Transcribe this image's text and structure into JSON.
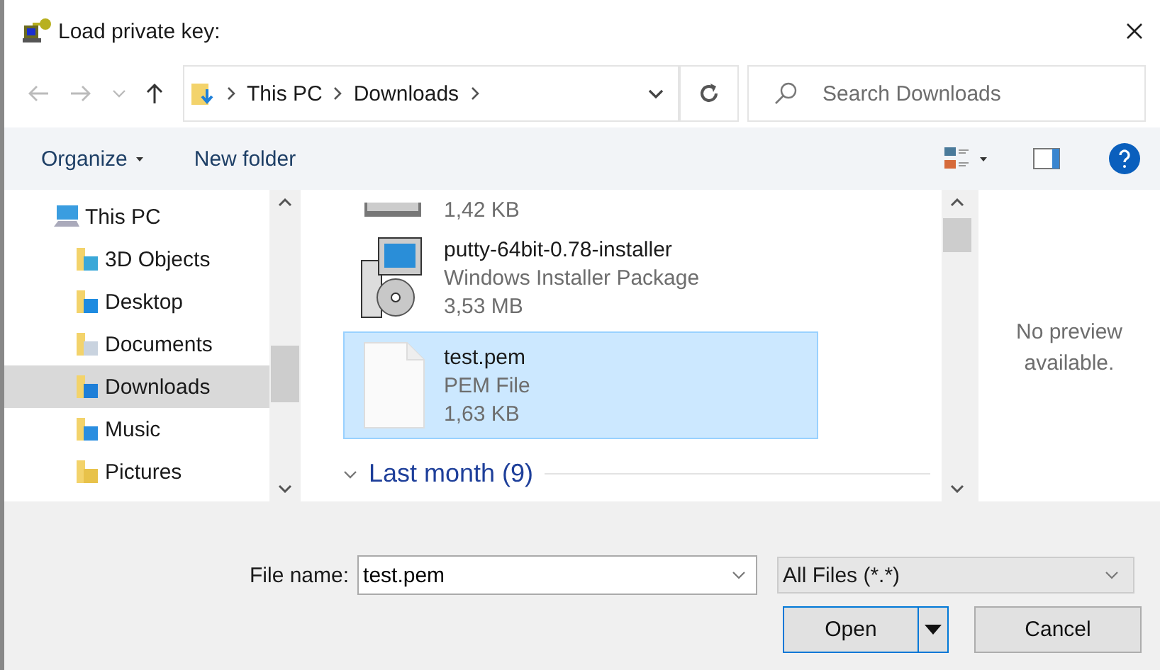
{
  "window": {
    "title": "Load private key:"
  },
  "address": {
    "crumbs": [
      "This PC",
      "Downloads"
    ]
  },
  "search": {
    "placeholder": "Search Downloads"
  },
  "toolbar": {
    "organize": "Organize",
    "new_folder": "New folder"
  },
  "nav": [
    {
      "label": "This PC",
      "kind": "pc",
      "selected": false,
      "children": [
        {
          "label": "3D Objects",
          "kind": "objects",
          "selected": false
        },
        {
          "label": "Desktop",
          "kind": "desktop",
          "selected": false
        },
        {
          "label": "Documents",
          "kind": "documents",
          "selected": false
        },
        {
          "label": "Downloads",
          "kind": "downloads",
          "selected": true
        },
        {
          "label": "Music",
          "kind": "music",
          "selected": false
        },
        {
          "label": "Pictures",
          "kind": "pictures",
          "selected": false
        }
      ]
    }
  ],
  "files": [
    {
      "kind": "drive",
      "size": "1,42 KB",
      "selected": false
    },
    {
      "kind": "installer",
      "name": "putty-64bit-0.78-installer",
      "type": "Windows Installer Package",
      "size": "3,53 MB",
      "selected": false
    },
    {
      "kind": "document",
      "name": "test.pem",
      "type": "PEM File",
      "size": "1,63 KB",
      "selected": true
    }
  ],
  "group": {
    "label": "Last month (9)",
    "expanded": true
  },
  "preview": {
    "text": "No preview available."
  },
  "file_name": {
    "label": "File name:",
    "value": "test.pem"
  },
  "file_type": {
    "value": "All Files (*.*)"
  },
  "buttons": {
    "open": "Open",
    "cancel": "Cancel"
  }
}
